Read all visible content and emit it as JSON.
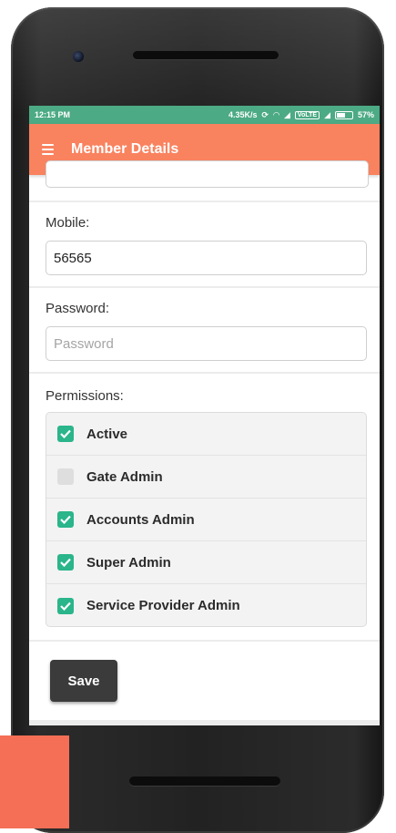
{
  "status_bar": {
    "time": "12:15 PM",
    "net_speed": "4.35K/s",
    "network_label": "VoLTE",
    "battery": "57%"
  },
  "app_bar": {
    "title": "Member Details",
    "menu_icon": "hamburger-menu-icon"
  },
  "form": {
    "mobile": {
      "label": "Mobile:",
      "value": "56565"
    },
    "password": {
      "label": "Password:",
      "value": "",
      "placeholder": "Password"
    },
    "permissions": {
      "label": "Permissions:",
      "items": [
        {
          "label": "Active",
          "checked": true
        },
        {
          "label": "Gate Admin",
          "checked": false
        },
        {
          "label": "Accounts Admin",
          "checked": true
        },
        {
          "label": "Super Admin",
          "checked": true
        },
        {
          "label": "Service Provider Admin",
          "checked": true
        }
      ]
    },
    "save_label": "Save"
  },
  "colors": {
    "app_bar": "#f9825f",
    "status_bar": "#4caa84",
    "checkbox_on": "#2ab58a",
    "save_button": "#3b3b3b",
    "corner_block": "#f46f55"
  }
}
